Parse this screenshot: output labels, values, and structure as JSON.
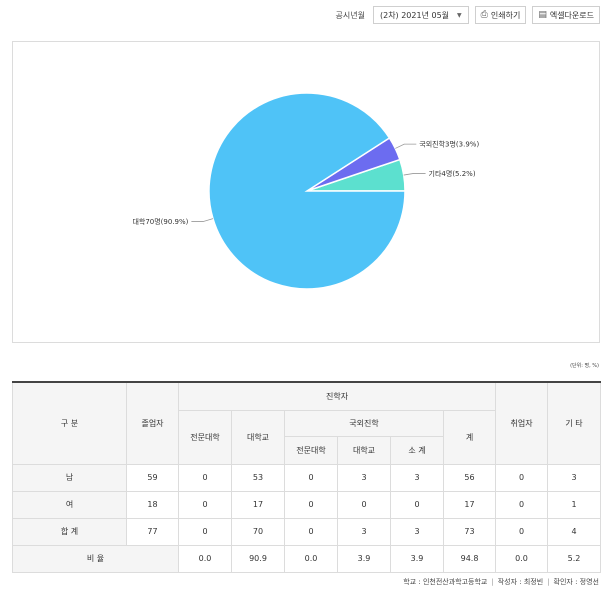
{
  "toolbar": {
    "label": "공시년월",
    "select_value": "(2차) 2021년 05월",
    "print_label": "인쇄하기",
    "excel_label": "엑셀다운로드"
  },
  "chart_data": {
    "type": "pie",
    "slices": [
      {
        "label": "대학70명(90.9%)",
        "value": 90.9,
        "color": "#4fc3f7"
      },
      {
        "label": "국외진학3명(3.9%)",
        "value": 3.9,
        "color": "#6c6cf0"
      },
      {
        "label": "기타4명(5.2%)",
        "value": 5.2,
        "color": "#5ce0cf"
      }
    ]
  },
  "unit_text": "(단위: 명, %)",
  "table": {
    "header": {
      "gubun": "구 분",
      "graduates": "졸업자",
      "advancing": "진학자",
      "junior_college": "전문대학",
      "university": "대학교",
      "overseas": "국외진학",
      "ov_junior_college": "전문대학",
      "ov_university": "대학교",
      "ov_subtotal": "소 계",
      "total": "계",
      "employed": "취업자",
      "other": "기 타"
    },
    "rows": [
      {
        "label": "남",
        "cells": [
          "59",
          "0",
          "53",
          "0",
          "3",
          "3",
          "56",
          "0",
          "3"
        ]
      },
      {
        "label": "여",
        "cells": [
          "18",
          "0",
          "17",
          "0",
          "0",
          "0",
          "17",
          "0",
          "1"
        ]
      },
      {
        "label": "합 계",
        "cells": [
          "77",
          "0",
          "70",
          "0",
          "3",
          "3",
          "73",
          "0",
          "4"
        ]
      }
    ],
    "ratio": {
      "label": "비 율",
      "cells": [
        "0.0",
        "90.9",
        "0.0",
        "3.9",
        "3.9",
        "94.8",
        "0.0",
        "5.2"
      ]
    }
  },
  "signature": {
    "school": "학교 : 인천전산과학고등학교",
    "writer": "작성자 : 최정빈",
    "checker": "확인자 : 정영선"
  }
}
